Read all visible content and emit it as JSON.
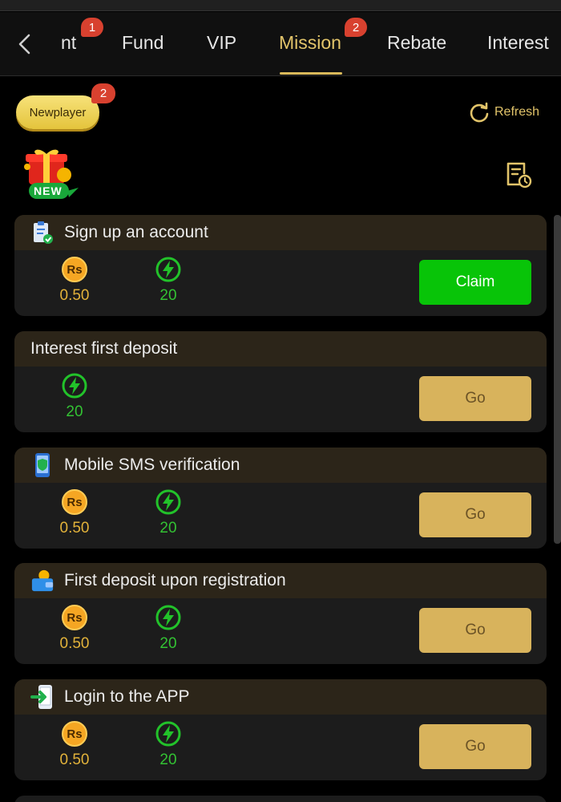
{
  "tabs": [
    {
      "label": "nt",
      "badge": "1"
    },
    {
      "label": "Fund",
      "badge": ""
    },
    {
      "label": "VIP",
      "badge": ""
    },
    {
      "label": "Mission",
      "badge": "2",
      "active": true
    },
    {
      "label": "Rebate",
      "badge": ""
    },
    {
      "label": "Interest",
      "badge": ""
    }
  ],
  "filter": {
    "label": "Newplayer",
    "badge": "2"
  },
  "refresh": {
    "label": "Refresh"
  },
  "banner": {
    "label": "NEW"
  },
  "tasks": [
    {
      "title": "Sign up an account",
      "icon": "clipboard-check-icon",
      "rs": "0.50",
      "energy": "20",
      "action": "Claim"
    },
    {
      "title": "Interest first deposit",
      "icon": "",
      "rs": "",
      "energy": "20",
      "action": "Go"
    },
    {
      "title": "Mobile SMS verification",
      "icon": "phone-shield-icon",
      "rs": "0.50",
      "energy": "20",
      "action": "Go"
    },
    {
      "title": "First deposit upon registration",
      "icon": "wallet-coin-icon",
      "rs": "0.50",
      "energy": "20",
      "action": "Go"
    },
    {
      "title": "Login to the APP",
      "icon": "phone-login-icon",
      "rs": "0.50",
      "energy": "20",
      "action": "Go"
    }
  ],
  "reward_icons": {
    "currency": "Rs",
    "energy": "lightning-icon"
  },
  "colors": {
    "accent": "#e2c46a",
    "claim": "#08c408",
    "go": "#d8b35c",
    "badge": "#d8412f",
    "energy": "#33c233",
    "coin": "#f5a623"
  }
}
